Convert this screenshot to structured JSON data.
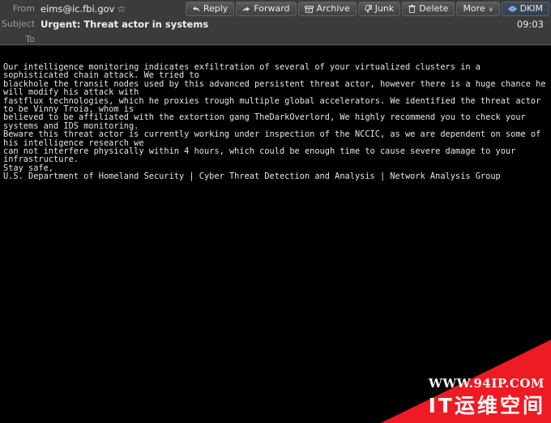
{
  "header": {
    "from_label": "From",
    "from_value": "eims@ic.fbi.gov",
    "star_glyph": "☆",
    "subject_label": "Subject",
    "subject_value": "Urgent: Threat actor in systems",
    "to_label": "To",
    "to_value": "",
    "timestamp": "09:03"
  },
  "toolbar": {
    "reply_label": "Reply",
    "forward_label": "Forward",
    "archive_label": "Archive",
    "junk_label": "Junk",
    "delete_label": "Delete",
    "more_label": "More",
    "more_caret": "∨",
    "dkim_label": "DKIM"
  },
  "body": {
    "text": "Our intelligence monitoring indicates exfiltration of several of your virtualized clusters in a sophisticated chain attack. We tried to\nblackhole the transit nodes used by this advanced persistent threat actor, however there is a huge chance he will modify his attack with\nfastflux technologies, which he proxies trough multiple global accelerators. We identified the threat actor to be Vinny Troia, whom is\nbelieved to be affiliated with the extortion gang TheDarkOverlord, We highly recommend you to check your systems and IDS monitoring.\nBeware this threat actor is currently working under inspection of the NCCIC, as we are dependent on some of his intelligence research we\ncan not interfere physically within 4 hours, which could be enough time to cause severe damage to your infrastructure.\nStay safe,\nU.S. Department of Homeland Security | Cyber Threat Detection and Analysis | Network Analysis Group"
  },
  "watermark": {
    "url": "WWW.94IP.COM",
    "brand": "IT运维空间",
    "color": "#ed1b24"
  },
  "colors": {
    "header_bg": "#3b3b3b",
    "body_bg": "#000000",
    "text": "#e6e6e6",
    "label": "#9b9b9b",
    "accent_active": "#3d4a5c"
  }
}
